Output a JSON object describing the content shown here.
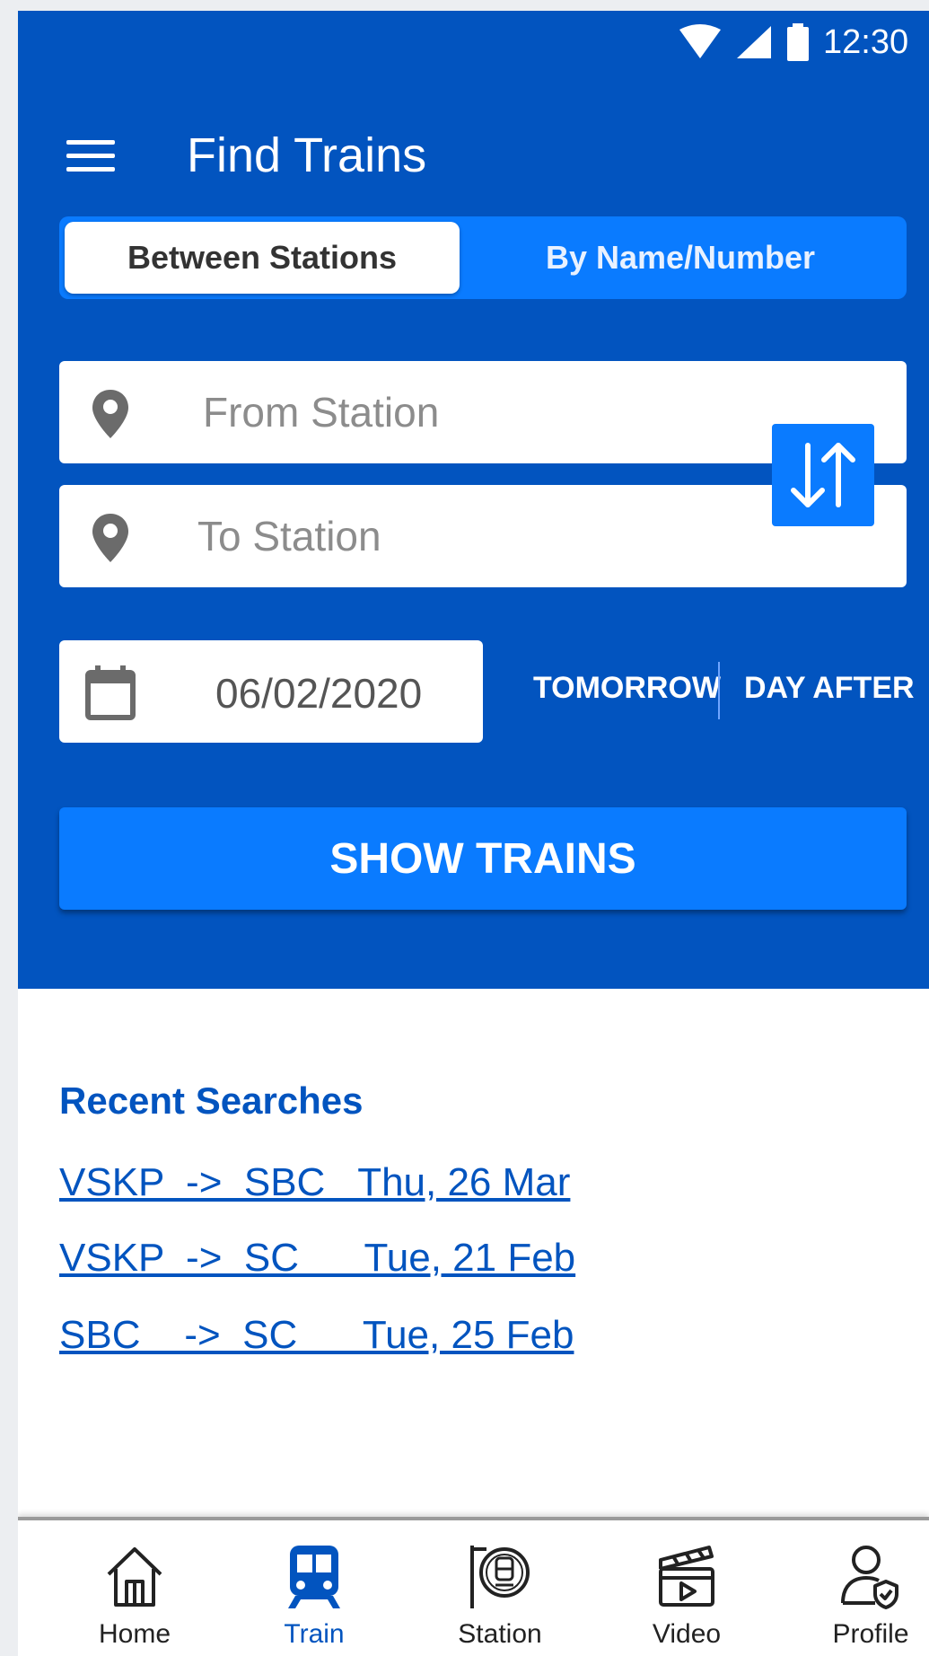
{
  "status_bar": {
    "time": "12:30"
  },
  "app_bar": {
    "title": "Find Trains"
  },
  "tabs": [
    {
      "label": "Between Stations",
      "active": true
    },
    {
      "label": "By Name/Number",
      "active": false
    }
  ],
  "search": {
    "from_placeholder": "From Station",
    "to_placeholder": "To Station",
    "date": "06/02/2020",
    "quick_dates": [
      "TOMORROW",
      "DAY AFTER"
    ],
    "submit_label": "SHOW TRAINS"
  },
  "recent": {
    "title": "Recent Searches",
    "items": [
      "VSKP  ->  SBC   Thu, 26 Mar",
      "VSKP  ->  SC      Tue, 21 Feb",
      "SBC    ->  SC      Tue, 25 Feb"
    ]
  },
  "bottom_nav": [
    {
      "label": "Home",
      "icon": "home-icon",
      "active": false
    },
    {
      "label": "Train",
      "icon": "train-icon",
      "active": true
    },
    {
      "label": "Station",
      "icon": "station-icon",
      "active": false
    },
    {
      "label": "Video",
      "icon": "video-icon",
      "active": false
    },
    {
      "label": "Profile",
      "icon": "profile-icon",
      "active": false
    }
  ],
  "colors": {
    "primary": "#0254bf",
    "accent": "#0a7bff",
    "icon_gray": "#6b6b6b"
  }
}
